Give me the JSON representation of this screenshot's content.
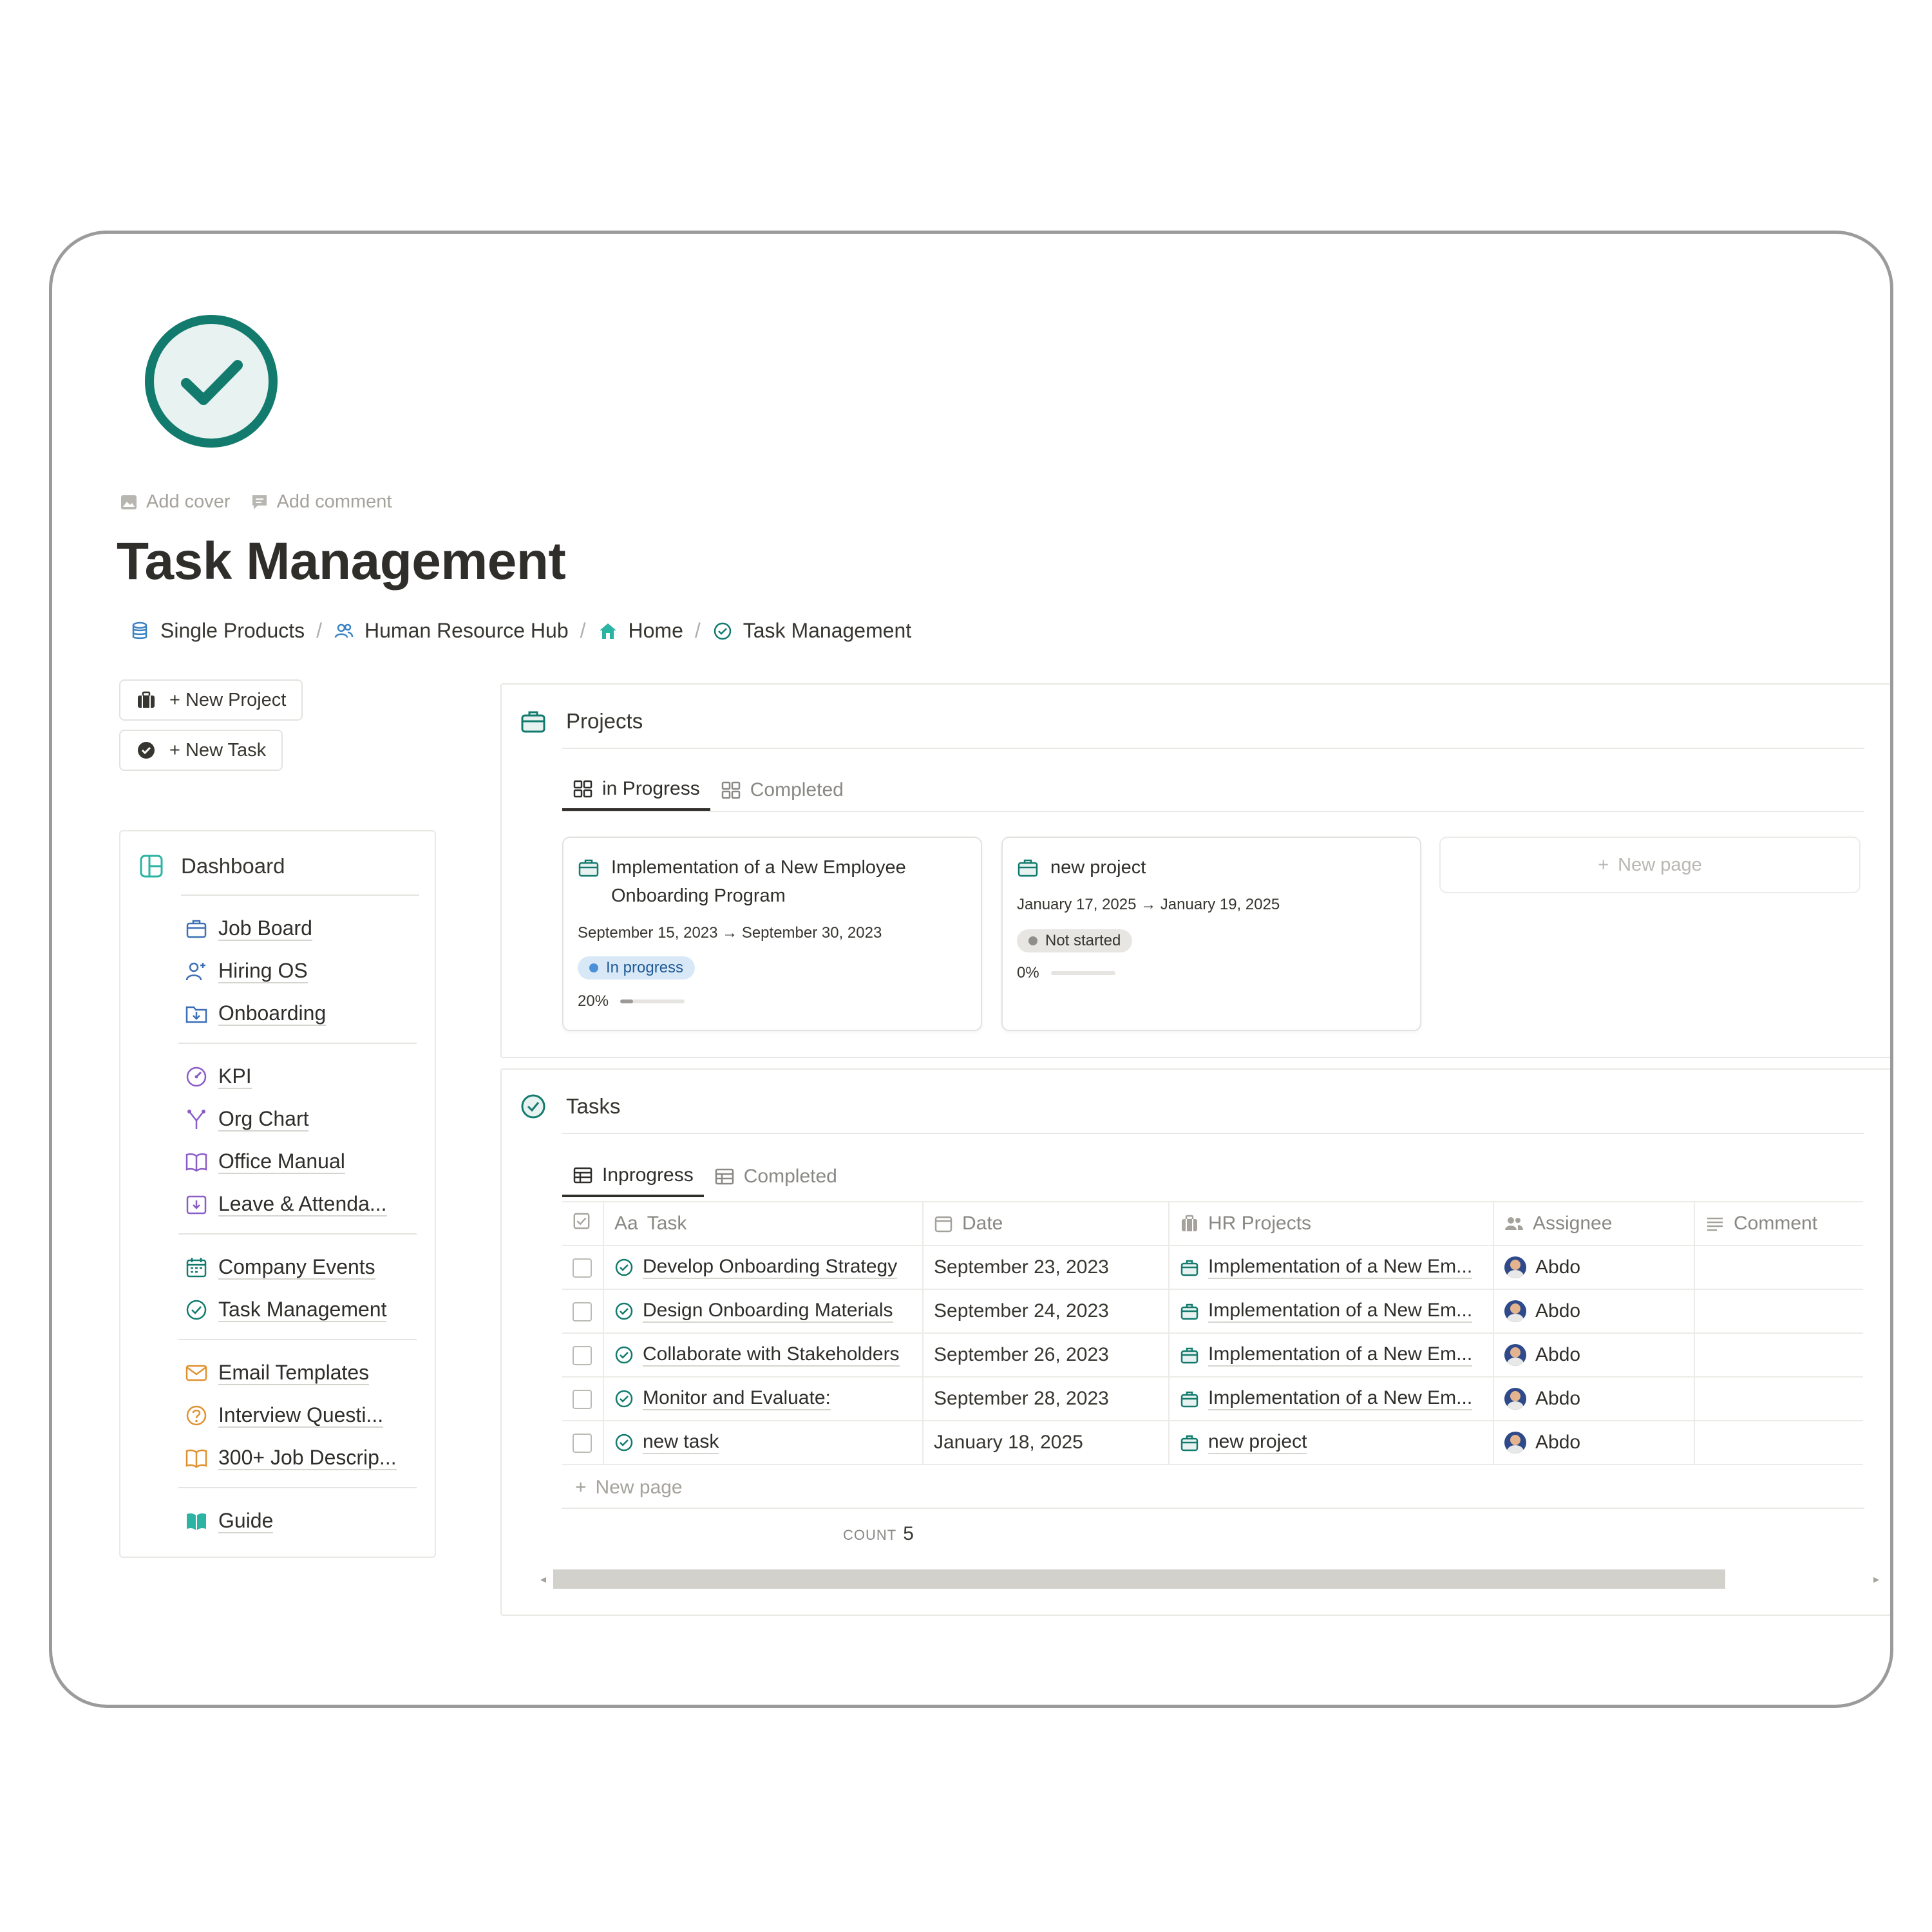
{
  "page": {
    "title": "Task Management",
    "meta": {
      "add_cover": "Add cover",
      "add_comment": "Add comment"
    },
    "accent_color": "#127b6e"
  },
  "breadcrumb": [
    {
      "label": "Single Products",
      "icon": "database-icon"
    },
    {
      "label": "Human Resource Hub",
      "icon": "people-icon"
    },
    {
      "label": "Home",
      "icon": "home-icon"
    },
    {
      "label": "Task Management",
      "icon": "check-circle-icon"
    }
  ],
  "breadcrumb_sep": "/",
  "actions": {
    "new_project": "+ New Project",
    "new_task": "+ New Task"
  },
  "sidebar": {
    "header": "Dashboard",
    "groups": [
      [
        "Job Board",
        "Hiring OS",
        "Onboarding"
      ],
      [
        "KPI",
        "Org Chart",
        "Office Manual",
        "Leave & Attenda..."
      ],
      [
        "Company Events",
        "Task Management"
      ],
      [
        "Email Templates",
        "Interview Questi...",
        "300+ Job Descrip..."
      ],
      [
        "Guide"
      ]
    ]
  },
  "projects": {
    "title": "Projects",
    "tabs": [
      "in Progress",
      "Completed"
    ],
    "cards": [
      {
        "title": "Implementation of a New Employee Onboarding Program",
        "date": "September 15, 2023 → September 30, 2023",
        "status": "In progress",
        "status_color": "#4a8fd8",
        "status_bg": "#d9e8f7",
        "progress_label": "20%",
        "progress": 0.2
      },
      {
        "title": "new project",
        "date": "January 17, 2025 → January 19, 2025",
        "status": "Not started",
        "status_color": "#8f8e8a",
        "status_bg": "#e7e6e3",
        "progress_label": "0%",
        "progress": 0
      }
    ],
    "new_page": "New page"
  },
  "tasks": {
    "title": "Tasks",
    "tabs": [
      "Inprogress",
      "Completed"
    ],
    "columns": [
      "Task",
      "Date",
      "HR Projects",
      "Assignee",
      "Comment"
    ],
    "title_prefix": "Aa",
    "rows": [
      {
        "task": "Develop Onboarding Strategy",
        "date": "September 23, 2023",
        "project": "Implementation of a New Em...",
        "assignee": "Abdo"
      },
      {
        "task": "Design Onboarding Materials",
        "date": "September 24, 2023",
        "project": "Implementation of a New Em...",
        "assignee": "Abdo"
      },
      {
        "task": "Collaborate with Stakeholders",
        "date": "September 26, 2023",
        "project": "Implementation of a New Em...",
        "assignee": "Abdo"
      },
      {
        "task": "Monitor and Evaluate:",
        "date": "September 28, 2023",
        "project": "Implementation of a New Em...",
        "assignee": "Abdo"
      },
      {
        "task": "new task",
        "date": "January 18, 2025",
        "project": "new project",
        "assignee": "Abdo"
      }
    ],
    "new_page": "New page",
    "count_label": "COUNT",
    "count_value": "5"
  }
}
